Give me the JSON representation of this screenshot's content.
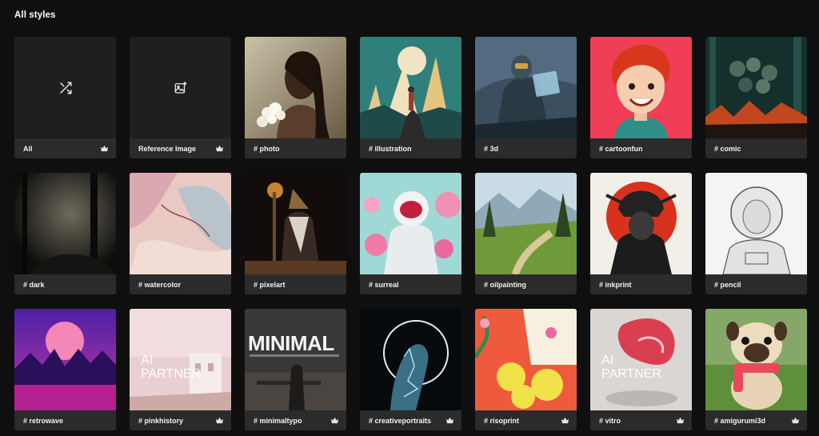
{
  "heading": "All styles",
  "cards": [
    {
      "label": "All",
      "premium": true
    },
    {
      "label": "Reference Image",
      "premium": true
    },
    {
      "label": "# photo",
      "premium": false
    },
    {
      "label": "# illustration",
      "premium": false
    },
    {
      "label": "# 3d",
      "premium": false
    },
    {
      "label": "# cartoonfun",
      "premium": false
    },
    {
      "label": "# comic",
      "premium": false
    },
    {
      "label": "# dark",
      "premium": false
    },
    {
      "label": "# watercolor",
      "premium": false
    },
    {
      "label": "# pixelart",
      "premium": false
    },
    {
      "label": "# surreal",
      "premium": false
    },
    {
      "label": "# oilpainting",
      "premium": false
    },
    {
      "label": "# inkprint",
      "premium": false
    },
    {
      "label": "# pencil",
      "premium": false
    },
    {
      "label": "# retrowave",
      "premium": false
    },
    {
      "label": "# pinkhistory",
      "premium": true
    },
    {
      "label": "# minimaltypo",
      "premium": true
    },
    {
      "label": "# creativeportraits",
      "premium": true
    },
    {
      "label": "# risoprint",
      "premium": true
    },
    {
      "label": "# vitro",
      "premium": true
    },
    {
      "label": "# amigurumi3d",
      "premium": true
    }
  ],
  "overlays": {
    "pinkhistory": "AI\nPARTNER",
    "minimaltypo": "MINIMAL",
    "vitro": "AI\nPARTNER"
  },
  "colors": {
    "background": "#0f0f0f",
    "card": "#2b2b2b",
    "text": "#ffffff"
  }
}
